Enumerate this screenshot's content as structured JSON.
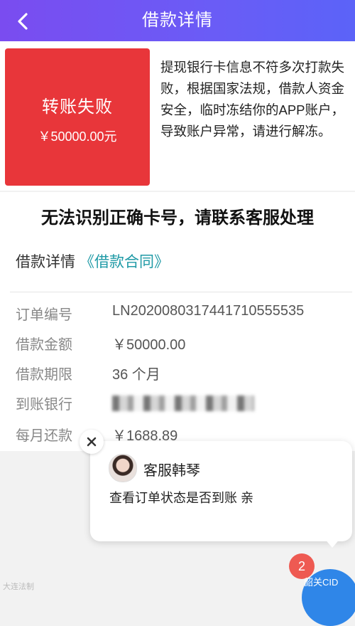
{
  "header": {
    "title": "借款详情"
  },
  "status": {
    "title": "转账失败",
    "amount": "￥50000.00元",
    "description": "提现银行卡信息不符多次打款失败，根据国家法规，借款人资金安全，临时冻结你的APP账户，导致账户异常，请进行解冻。"
  },
  "notice": {
    "title": "无法识别正确卡号，请联系客服处理",
    "loan_detail_label": "借款详情",
    "contract_link": "《借款合同》"
  },
  "details": [
    {
      "label": "订单编号",
      "value": "LN2020080317441710555535"
    },
    {
      "label": "借款金额",
      "value": "￥50000.00"
    },
    {
      "label": "借款期限",
      "value": "36 个月"
    },
    {
      "label": "到账银行",
      "value": ""
    },
    {
      "label": "每月还款",
      "value": "￥1688.89"
    }
  ],
  "chat": {
    "agent_name": "客服韩琴",
    "message": "查看订单状态是否到账 亲",
    "unread_count": "2"
  },
  "watermarks": {
    "left": "大连法制",
    "right": "韶关CID"
  },
  "colors": {
    "header": "#7a4cf0",
    "status_card": "#e8363a",
    "link": "#1f9aa6",
    "badge": "#ee5a52",
    "fab": "#2f86e8"
  }
}
